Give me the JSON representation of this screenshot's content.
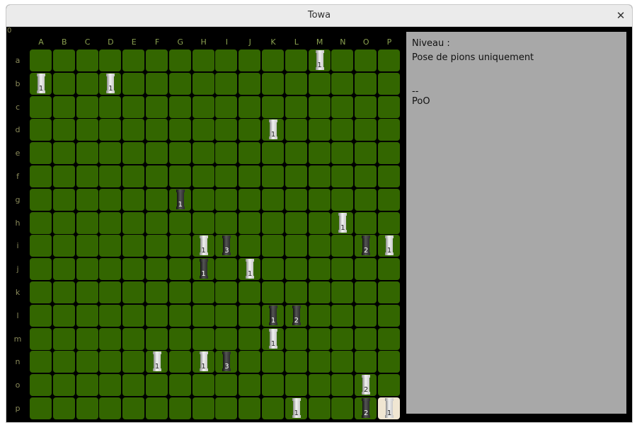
{
  "window": {
    "title": "Towa"
  },
  "board": {
    "corner_label": "0",
    "columns": [
      "A",
      "B",
      "C",
      "D",
      "E",
      "F",
      "G",
      "H",
      "I",
      "J",
      "K",
      "L",
      "M",
      "N",
      "O",
      "P"
    ],
    "rows": [
      "a",
      "b",
      "c",
      "d",
      "e",
      "f",
      "g",
      "h",
      "i",
      "j",
      "k",
      "l",
      "m",
      "n",
      "o",
      "p"
    ],
    "cell_color": "#336600",
    "white_piece_color": "#c8c8c8",
    "black_piece_color": "#2a2a2a",
    "selected_cell": "pP",
    "pieces": [
      {
        "cell": "aM",
        "color": "white",
        "height": "1"
      },
      {
        "cell": "bA",
        "color": "white",
        "height": "1"
      },
      {
        "cell": "bD",
        "color": "white",
        "height": "1"
      },
      {
        "cell": "dK",
        "color": "white",
        "height": "1"
      },
      {
        "cell": "gG",
        "color": "black",
        "height": "1"
      },
      {
        "cell": "hN",
        "color": "white",
        "height": "1"
      },
      {
        "cell": "iH",
        "color": "white",
        "height": "1"
      },
      {
        "cell": "iI",
        "color": "black",
        "height": "3"
      },
      {
        "cell": "iO",
        "color": "black",
        "height": "2"
      },
      {
        "cell": "iP",
        "color": "white",
        "height": "1"
      },
      {
        "cell": "jH",
        "color": "black",
        "height": "1"
      },
      {
        "cell": "jJ",
        "color": "white",
        "height": "1"
      },
      {
        "cell": "lK",
        "color": "black",
        "height": "1"
      },
      {
        "cell": "lL",
        "color": "black",
        "height": "2"
      },
      {
        "cell": "mK",
        "color": "white",
        "height": "1"
      },
      {
        "cell": "nF",
        "color": "white",
        "height": "1"
      },
      {
        "cell": "nH",
        "color": "white",
        "height": "1"
      },
      {
        "cell": "nI",
        "color": "black",
        "height": "3"
      },
      {
        "cell": "oO",
        "color": "white",
        "height": "2"
      },
      {
        "cell": "pL",
        "color": "white",
        "height": "1"
      },
      {
        "cell": "pO",
        "color": "black",
        "height": "2"
      },
      {
        "cell": "pP",
        "color": "white",
        "height": "1"
      }
    ]
  },
  "info_panel": {
    "level_label": "Niveau :",
    "mode_text": "Pose de pions uniquement",
    "separator": "--",
    "player_text": "PoO"
  }
}
